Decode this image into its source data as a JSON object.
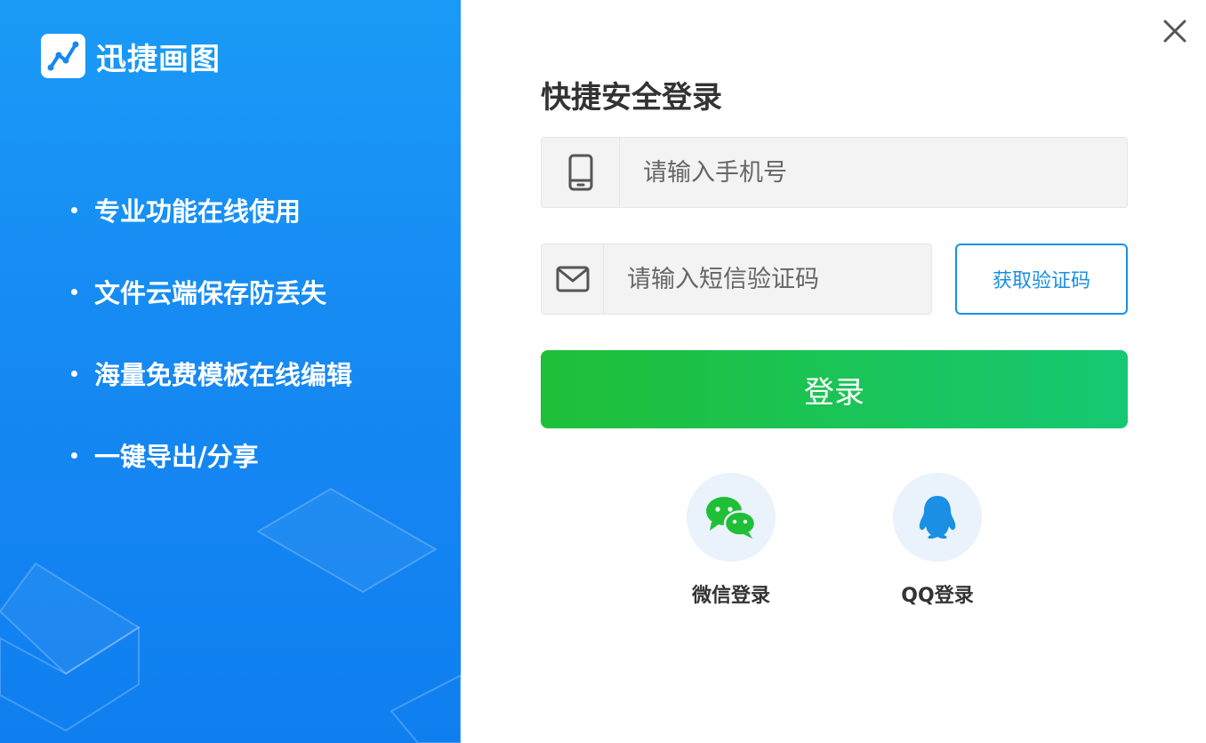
{
  "brand": {
    "name": "迅捷画图"
  },
  "features": [
    {
      "label": "专业功能在线使用"
    },
    {
      "label": "文件云端保存防丢失"
    },
    {
      "label": "海量免费模板在线编辑"
    },
    {
      "label": "一键导出/分享"
    }
  ],
  "form": {
    "title": "快捷安全登录",
    "phone_placeholder": "请输入手机号",
    "code_placeholder": "请输入短信验证码",
    "get_code_label": "获取验证码",
    "login_label": "登录"
  },
  "social": {
    "wechat_label": "微信登录",
    "qq_label": "QQ登录"
  },
  "colors": {
    "panel_blue": "#1587f2",
    "login_green": "#1fbf38",
    "link_blue": "#1a8fe3"
  }
}
